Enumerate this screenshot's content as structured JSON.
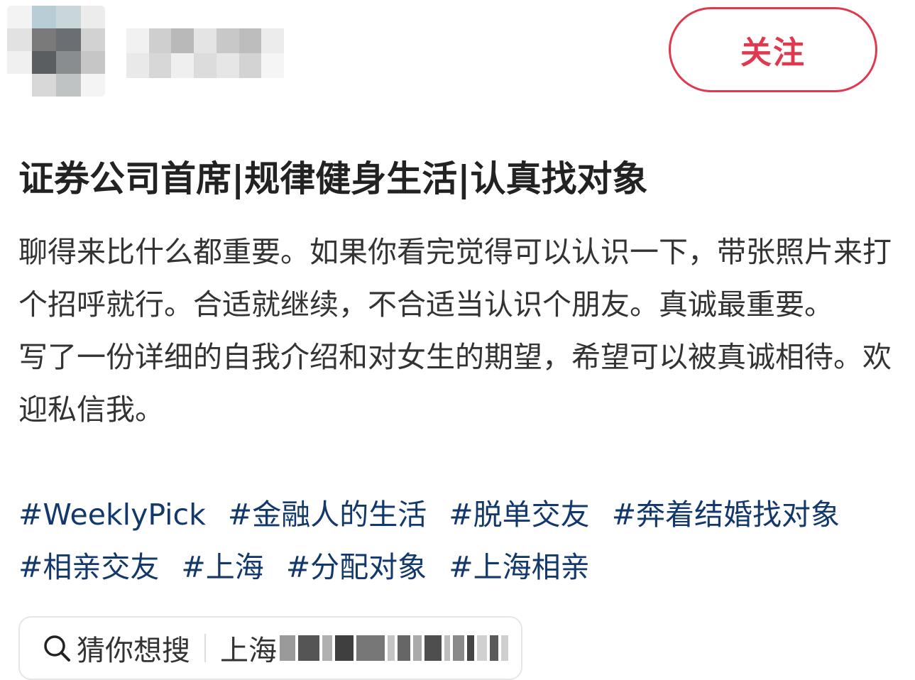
{
  "header": {
    "follow_label": "关注"
  },
  "post": {
    "title": "证券公司首席|规律健身生活|认真找对象",
    "paragraphs": [
      "聊得来比什么都重要。如果你看完觉得可以认识一下，带张照片来打个招呼就行。合适就继续，不合适当认识个朋友。真诚最重要。",
      "写了一份详细的自我介绍和对女生的期望，希望可以被真诚相待。欢迎私信我。"
    ],
    "tags": [
      "#WeeklyPick",
      "#金融人的生活",
      "#脱单交友",
      "#奔着结婚找对象",
      "#相亲交友",
      "#上海",
      "#分配对象",
      "#上海相亲"
    ]
  },
  "search": {
    "label": "猜你想搜",
    "query_visible": "上海"
  },
  "colors": {
    "accent": "#e0394f",
    "tag": "#13386c",
    "text": "#333333"
  }
}
